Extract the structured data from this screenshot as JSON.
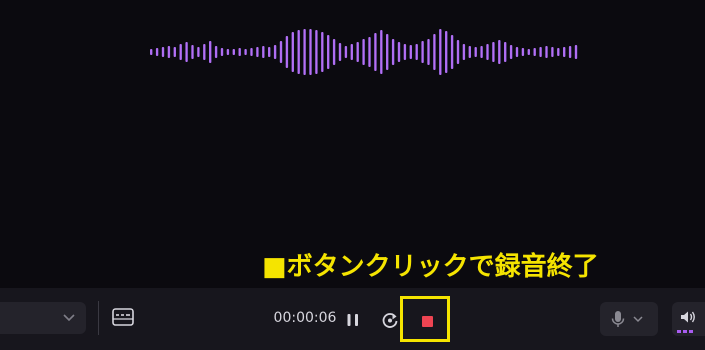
{
  "annotation": {
    "text": "■ボタンクリックで録音終了"
  },
  "toolbar": {
    "timer": "00:00:06",
    "device_select_icon": "chevron-down-icon",
    "captions_icon": "captions-icon",
    "pause_icon": "pause-icon",
    "redo_icon": "redo-icon",
    "stop_icon": "stop-icon",
    "mic_icon": "microphone-icon",
    "speaker_icon": "speaker-icon"
  },
  "colors": {
    "background": "#0b0a0f",
    "toolbar": "#17161d",
    "wave_left": "#b06cf2",
    "wave_right": "#8f6cf0",
    "highlight": "#f5e400",
    "stop": "#ee4452"
  }
}
